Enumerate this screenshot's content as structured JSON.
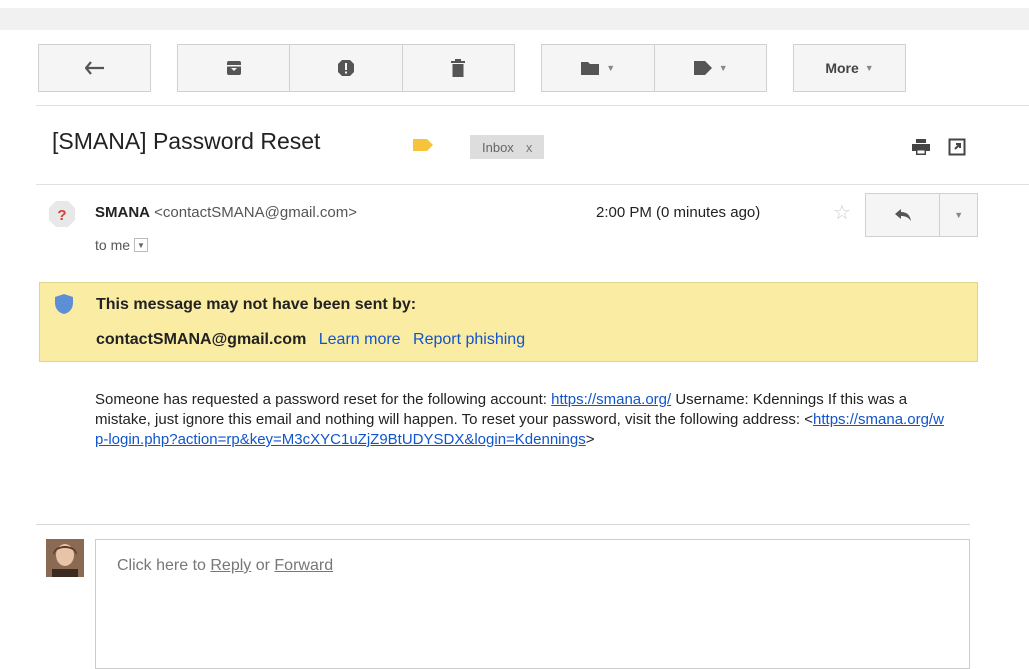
{
  "toolbar": {
    "more_label": "More",
    "buttons": [
      "back-icon",
      "archive-icon",
      "report-spam-icon",
      "delete-icon",
      "move-to-icon",
      "labels-icon"
    ]
  },
  "subject": {
    "title": "[SMANA] Password Reset",
    "inbox_label": "Inbox",
    "inbox_remove": "x"
  },
  "message": {
    "sender_name": "SMANA",
    "sender_email": "<contactSMANA@gmail.com>",
    "to_line": "to me",
    "time": "2:00 PM (0 minutes ago)"
  },
  "warning": {
    "headline": "This message may not have been sent by:",
    "email": "contactSMANA@gmail.com",
    "learn_more": "Learn more",
    "report_phishing": "Report phishing",
    "color": "#fbeca3"
  },
  "body": {
    "text1": "Someone has requested a password reset for the following account: ",
    "link1": "https://smana.org/",
    "text2": " Username: Kdennings If this was a mistake, just ignore this email and nothing will happen. To reset your password, visit the following address: <",
    "link2": "https://smana.org/wp-login.php?action=rp&key=M3cXYC1uZjZ9BtUDYSDX&login=Kdennings",
    "text3": ">"
  },
  "reply": {
    "prefix": "Click here to ",
    "reply": "Reply",
    "or": " or ",
    "forward": "Forward"
  },
  "colors": {
    "link": "#1155cc",
    "importance": "#f6c33b",
    "shield": "#5d8fd6"
  }
}
